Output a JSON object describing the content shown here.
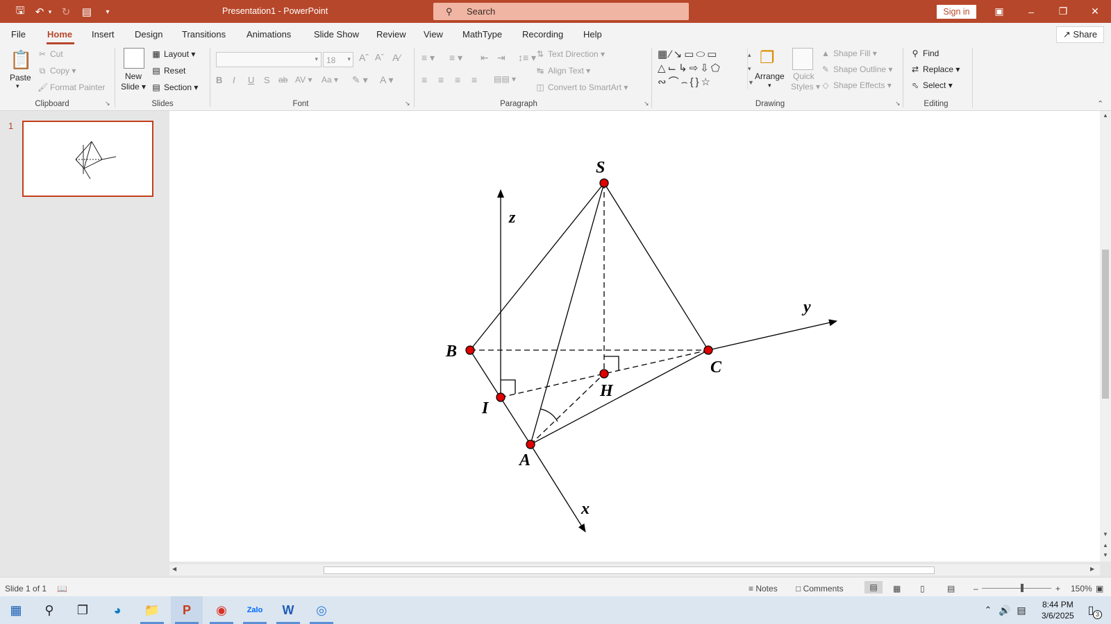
{
  "app": {
    "title": "Presentation1  -  PowerPoint",
    "sign_in": "Sign in",
    "share": "Share"
  },
  "search": {
    "label": "Search"
  },
  "tabs": [
    {
      "label": "File"
    },
    {
      "label": "Home"
    },
    {
      "label": "Insert"
    },
    {
      "label": "Design"
    },
    {
      "label": "Transitions"
    },
    {
      "label": "Animations"
    },
    {
      "label": "Slide Show"
    },
    {
      "label": "Review"
    },
    {
      "label": "View"
    },
    {
      "label": "MathType"
    },
    {
      "label": "Recording"
    },
    {
      "label": "Help"
    }
  ],
  "ribbon": {
    "clipboard": {
      "paste": "Paste",
      "cut": "Cut",
      "copy": "Copy",
      "format_painter": "Format Painter",
      "label": "Clipboard"
    },
    "slides": {
      "new_slide_1": "New",
      "new_slide_2": "Slide",
      "layout": "Layout",
      "reset": "Reset",
      "section": "Section",
      "label": "Slides"
    },
    "font": {
      "size": "18",
      "bold": "B",
      "italic": "I",
      "underline": "U",
      "shadow": "S",
      "strike": "ab",
      "spacing": "AV",
      "case": "Aa",
      "label": "Font"
    },
    "paragraph": {
      "text_direction": "Text Direction",
      "align_text": "Align Text",
      "smartart": "Convert to SmartArt",
      "label": "Paragraph"
    },
    "drawing": {
      "arrange": "Arrange",
      "quick_1": "Quick",
      "quick_2": "Styles",
      "shape_fill": "Shape Fill",
      "shape_outline": "Shape Outline",
      "shape_effects": "Shape Effects",
      "label": "Drawing"
    },
    "editing": {
      "find": "Find",
      "replace": "Replace",
      "select": "Select",
      "label": "Editing"
    }
  },
  "thumbnail": {
    "number": "1"
  },
  "slide": {
    "labels": {
      "S": "S",
      "B": "B",
      "C": "C",
      "H": "H",
      "I": "I",
      "A": "A",
      "x": "x",
      "y": "y",
      "z": "z"
    }
  },
  "status": {
    "slide_info": "Slide 1 of 1",
    "notes": "Notes",
    "comments": "Comments",
    "zoom": "150%"
  },
  "taskbar": {
    "time": "8:44 PM",
    "date": "3/6/2025",
    "notif_count": "3"
  },
  "colors": {
    "accent": "#b7472a",
    "point": "#e00000"
  }
}
